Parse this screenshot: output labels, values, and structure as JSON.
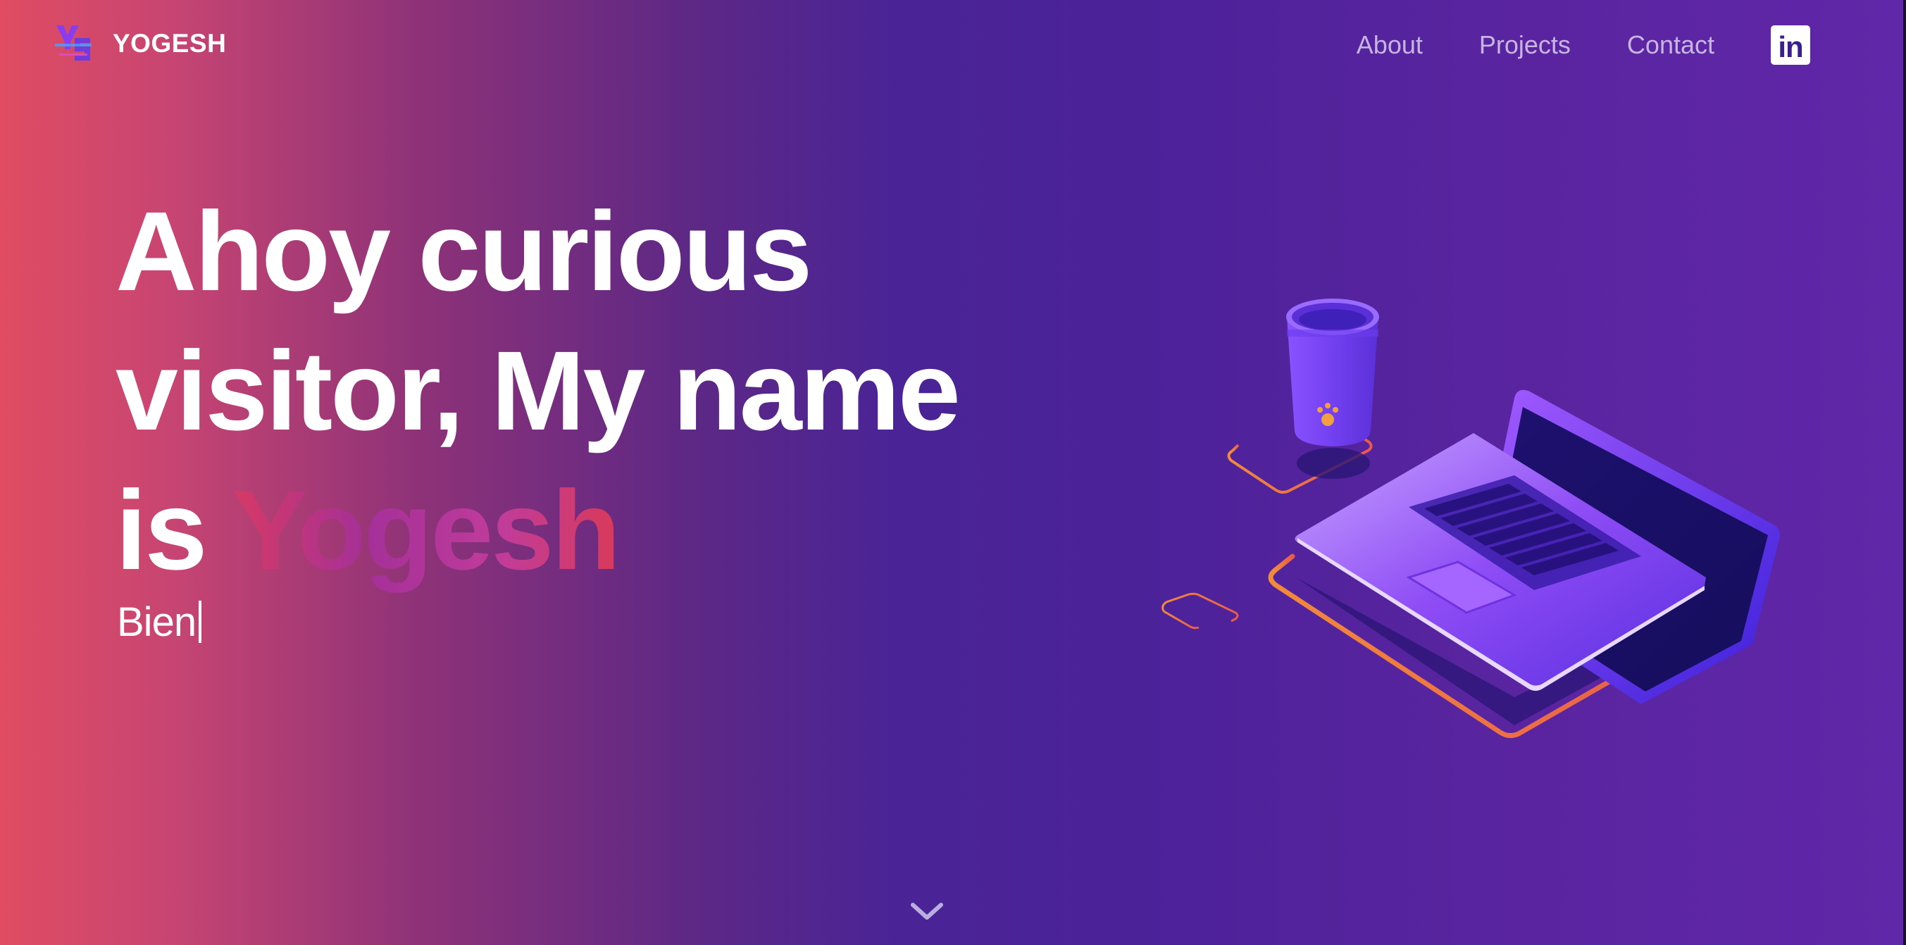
{
  "header": {
    "logo_text": "YOGESH",
    "nav": [
      {
        "label": "About"
      },
      {
        "label": "Projects"
      },
      {
        "label": "Contact"
      }
    ],
    "social": {
      "icon": "linkedin-icon",
      "glyph": "in"
    }
  },
  "hero": {
    "line1": "Ahoy curious",
    "line2": "visitor, My name",
    "line3_prefix": "is",
    "name": "Yogesh",
    "typed_text": "Bien"
  },
  "colors": {
    "gradient_left": "#e04c62",
    "gradient_mid": "#4a2496",
    "gradient_right": "#6027a8",
    "accent_orange": "#f07a3c"
  },
  "icons": {
    "scroll": "chevron-down-icon",
    "illustration": "laptop-and-cup-illustration"
  }
}
